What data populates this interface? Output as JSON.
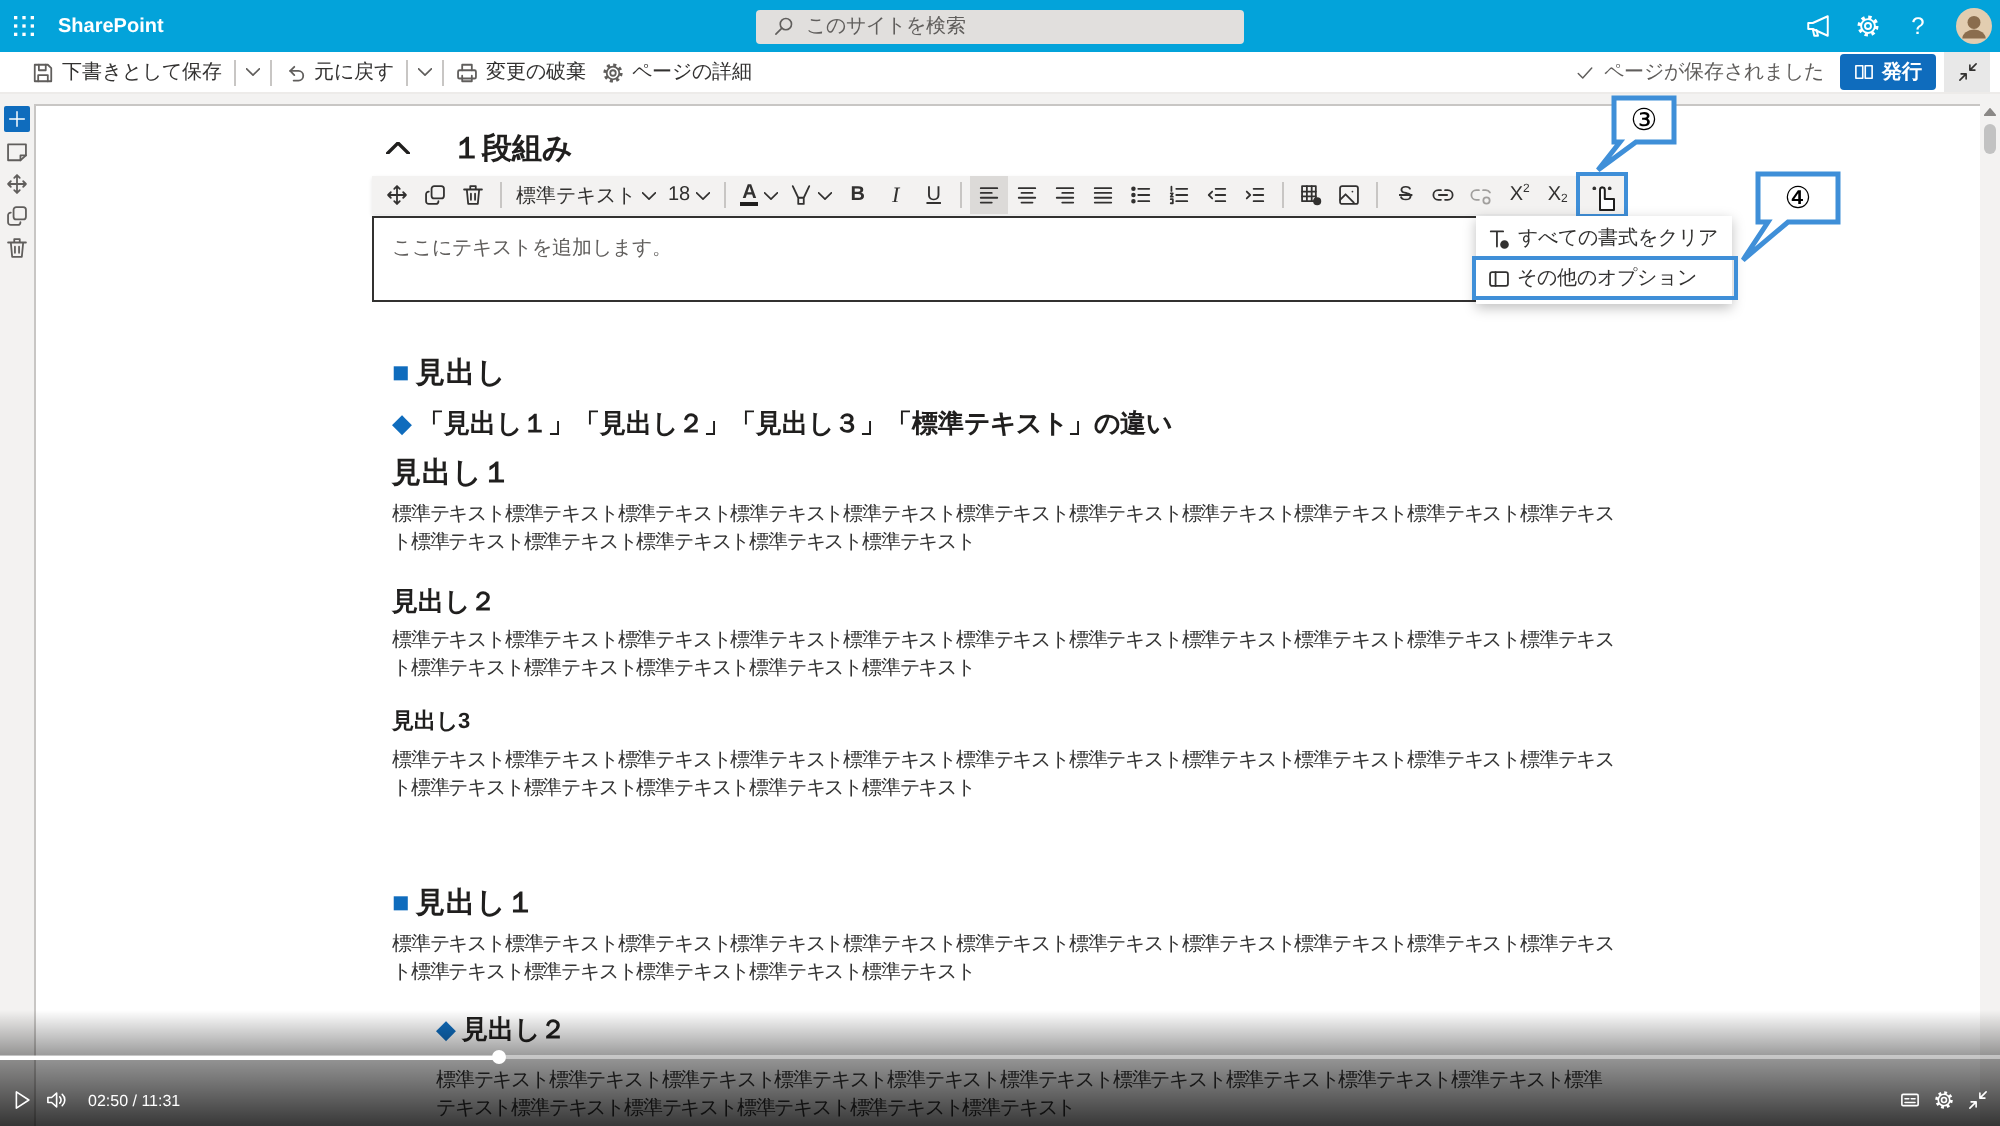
{
  "top_bar": {
    "app_name": "SharePoint",
    "search": {
      "placeholder": "このサイトを検索"
    },
    "help": "?"
  },
  "command_bar": {
    "items": [
      {
        "kind": "save",
        "label": "下書きとして保存",
        "has_menu": true
      },
      {
        "kind": "undo",
        "label": "元に戻す",
        "has_menu": true
      },
      {
        "kind": "discard",
        "label": "変更の破棄",
        "has_menu": false
      },
      {
        "kind": "details",
        "label": "ページの詳細",
        "has_menu": false
      }
    ],
    "status": "ページが保存されました",
    "publish": "発行"
  },
  "section": {
    "title": "１段組み",
    "expanded": true
  },
  "toolbar": {
    "style": "標準テキスト",
    "size": "18",
    "color_label": "A",
    "text_buttons": [
      {
        "kind": "bold",
        "label": "B"
      },
      {
        "kind": "italic",
        "label": "I"
      },
      {
        "kind": "underline",
        "label": "U"
      }
    ],
    "paragraph_buttons": [
      {
        "kind": "align_left",
        "selected": true
      },
      {
        "kind": "align_center",
        "selected": false
      },
      {
        "kind": "align_right",
        "selected": false
      },
      {
        "kind": "justify",
        "selected": false
      },
      {
        "kind": "bullets",
        "selected": false
      },
      {
        "kind": "numbering",
        "selected": false
      },
      {
        "kind": "outdent",
        "selected": false
      },
      {
        "kind": "indent",
        "selected": false
      }
    ],
    "strike_label": "S",
    "script_buttons": [
      {
        "kind": "superscript",
        "label": "X",
        "index": "2"
      },
      {
        "kind": "subscript",
        "label": "X",
        "index": "2"
      }
    ]
  },
  "editor": {
    "placeholder": "ここにテキストを追加します。"
  },
  "more_menu": {
    "items": [
      {
        "kind": "clear",
        "label": "すべての書式をクリア"
      },
      {
        "kind": "options",
        "label": "その他のオプション"
      }
    ]
  },
  "callouts": [
    {
      "label": "③"
    },
    {
      "label": "④"
    }
  ],
  "content": {
    "sections": [
      {
        "blocks": [
          {
            "kind": "h1",
            "marker": "■",
            "text": "見出し"
          },
          {
            "kind": "h2",
            "marker": "◆",
            "text": "「見出し１」「見出し２」「見出し３」「標準テキスト」の違い"
          },
          {
            "kind": "h1",
            "text": "見出し１"
          },
          {
            "kind": "p",
            "text": "標準テキスト標準テキスト標準テキスト標準テキスト標準テキスト標準テキスト標準テキスト標準テキスト標準テキスト標準テキスト標準テキスト標準テキスト標準テキスト標準テキスト標準テキスト標準テキスト"
          },
          {
            "kind": "h2",
            "text": "見出し２"
          },
          {
            "kind": "p",
            "text": "標準テキスト標準テキスト標準テキスト標準テキスト標準テキスト標準テキスト標準テキスト標準テキスト標準テキスト標準テキスト標準テキスト標準テキスト標準テキスト標準テキスト標準テキスト標準テキスト"
          },
          {
            "kind": "h3",
            "text": "見出し3"
          },
          {
            "kind": "p",
            "text": "標準テキスト標準テキスト標準テキスト標準テキスト標準テキスト標準テキスト標準テキスト標準テキスト標準テキスト標準テキスト標準テキスト標準テキスト標準テキスト標準テキスト標準テキスト標準テキスト"
          }
        ]
      },
      {
        "blocks": [
          {
            "kind": "h1",
            "marker": "■",
            "text": "見出し１"
          },
          {
            "kind": "p",
            "text": "標準テキスト標準テキスト標準テキスト標準テキスト標準テキスト標準テキスト標準テキスト標準テキスト標準テキスト標準テキスト標準テキスト標準テキスト標準テキスト標準テキスト標準テキスト標準テキスト"
          },
          {
            "kind": "indent",
            "children": [
              {
                "kind": "h2",
                "marker": "◆",
                "text": "見出し２"
              },
              {
                "kind": "p",
                "text": "標準テキスト標準テキスト標準テキスト標準テキスト標準テキスト標準テキスト標準テキスト標準テキスト標準テキスト標準テキスト標準テキスト標準テキスト標準テキスト標準テキスト標準テキスト標準テキスト"
              }
            ]
          }
        ]
      }
    ]
  },
  "video_player": {
    "time": "02:50 / 11:31",
    "level": 0.249
  }
}
